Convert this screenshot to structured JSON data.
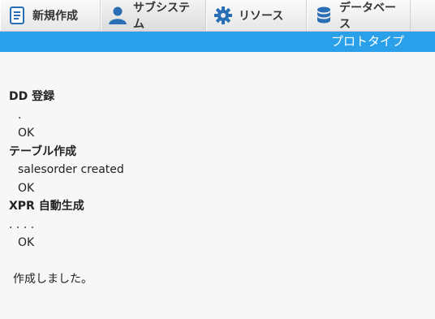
{
  "toolbar": {
    "items": [
      {
        "label": "新規作成",
        "icon": "new-document-icon"
      },
      {
        "label": "サブシステム",
        "icon": "user-icon"
      },
      {
        "label": "リソース",
        "icon": "gear-icon"
      },
      {
        "label": "データベース",
        "icon": "database-icon"
      }
    ]
  },
  "banner": {
    "text": "プロトタイプ"
  },
  "log": {
    "dd_title": "DD 登録",
    "dd_progress": ".",
    "dd_status": "OK",
    "table_title": "テーブル作成",
    "table_line": "salesorder created",
    "table_status": "OK",
    "xpr_title": "XPR 自動生成",
    "xpr_progress": ". . . .",
    "xpr_status": "OK",
    "done": "作成しました。"
  },
  "colors": {
    "accent": "#2aa0ea",
    "icon": "#2a6fb5"
  }
}
